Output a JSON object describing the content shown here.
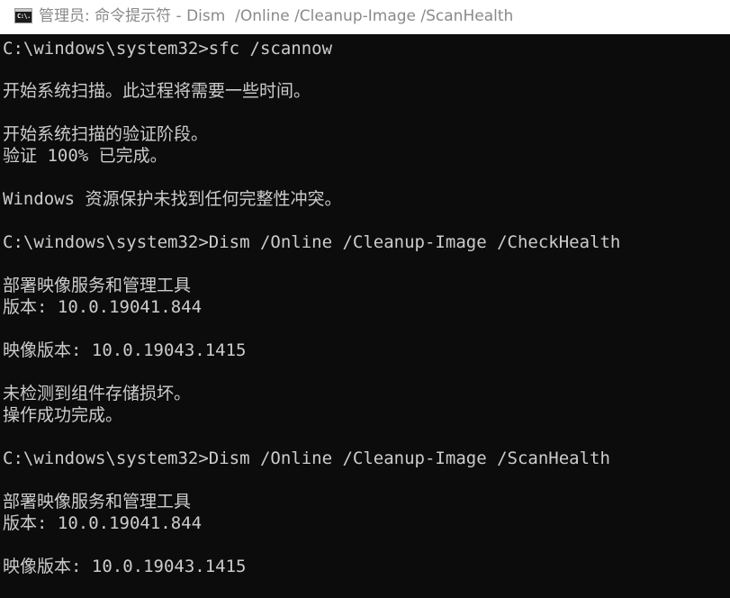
{
  "window": {
    "title": "管理员: 命令提示符 - Dism  /Online /Cleanup-Image /ScanHealth",
    "icon": "cmd-icon",
    "icon_text": "C:\\."
  },
  "console": {
    "background": "#0c0c0c",
    "foreground": "#cccccc",
    "lines": [
      "C:\\windows\\system32>sfc /scannow",
      "开始系统扫描。此过程将需要一些时间。",
      "开始系统扫描的验证阶段。",
      "验证 100% 已完成。",
      "Windows 资源保护未找到任何完整性冲突。",
      "C:\\windows\\system32>Dism /Online /Cleanup-Image /CheckHealth",
      "部署映像服务和管理工具",
      "版本: 10.0.19041.844",
      "映像版本: 10.0.19043.1415",
      "未检测到组件存储损坏。",
      "操作成功完成。",
      "C:\\windows\\system32>Dism /Online /Cleanup-Image /ScanHealth",
      "部署映像服务和管理工具",
      "版本: 10.0.19041.844",
      "映像版本: 10.0.19043.1415"
    ]
  }
}
